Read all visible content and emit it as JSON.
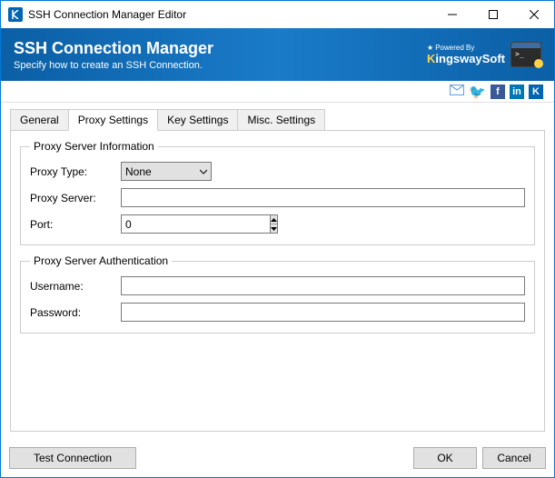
{
  "window": {
    "title": "SSH Connection Manager Editor"
  },
  "header": {
    "title": "SSH Connection Manager",
    "subtitle": "Specify how to create an SSH Connection.",
    "powered_by": "Powered By",
    "brand_prefix": "K",
    "brand_rest": "ingswaySoft"
  },
  "tabs": {
    "general": "General",
    "proxy": "Proxy Settings",
    "key": "Key Settings",
    "misc": "Misc. Settings"
  },
  "fieldsets": {
    "info_legend": "Proxy Server Information",
    "auth_legend": "Proxy Server Authentication"
  },
  "labels": {
    "proxy_type": "Proxy Type:",
    "proxy_server": "Proxy Server:",
    "port": "Port:",
    "username": "Username:",
    "password": "Password:"
  },
  "values": {
    "proxy_type": "None",
    "proxy_server": "",
    "port": "0",
    "username": "",
    "password": ""
  },
  "buttons": {
    "test": "Test Connection",
    "ok": "OK",
    "cancel": "Cancel"
  }
}
